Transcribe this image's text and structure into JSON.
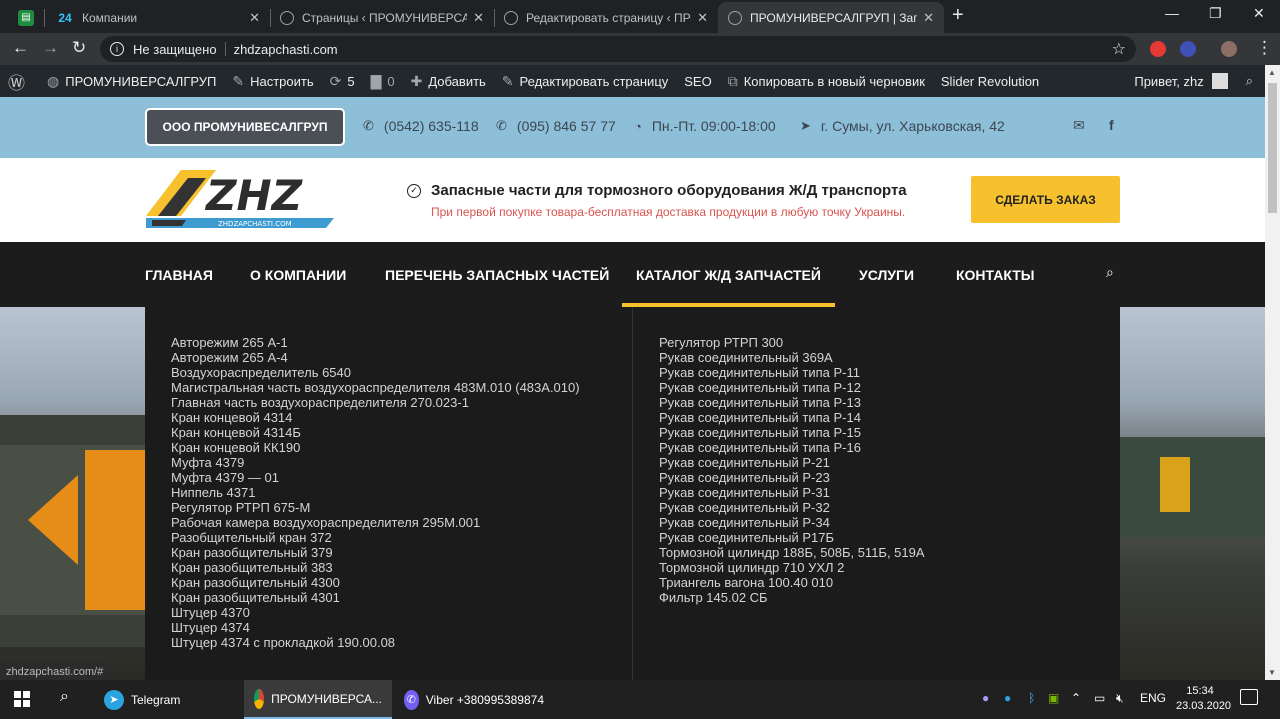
{
  "browser": {
    "tabs": [
      {
        "title": "",
        "favicon": "sheets-icon",
        "color": "#1e8e3e"
      },
      {
        "title": "Компании",
        "favicon": "bitrix24-icon",
        "favicon_text": "24",
        "color": "#2fc6f6"
      },
      {
        "title": "Страницы ‹ ПРОМУНИВЕРСАЛГ",
        "favicon": "globe-icon",
        "color": "#5f6368"
      },
      {
        "title": "Редактировать страницу ‹ ПРОМ",
        "favicon": "globe-icon",
        "color": "#5f6368"
      },
      {
        "title": "ПРОМУНИВЕРСАЛГРУП | Запчас",
        "favicon": "globe-icon",
        "color": "#5f6368"
      }
    ],
    "new_tab": "+",
    "security_label": "Не защищено",
    "url": "zhdzapchasti.com"
  },
  "wp_admin": {
    "site_name": "ПРОМУНИВЕРСАЛГРУП",
    "customize": "Настроить",
    "updates_count": "5",
    "comments_count": "0",
    "add_new": "Добавить",
    "edit_page": "Редактировать страницу",
    "seo": "SEO",
    "copy_draft": "Копировать в новый черновик",
    "slider": "Slider Revolution",
    "greeting": "Привет, zhz"
  },
  "site": {
    "company_button": "ООО ПРОМУНИВЕСАЛГРУП",
    "phone1": "(0542) 635-118",
    "phone2": "(095) 846 57 77",
    "hours": "Пн.-Пт. 09:00-18:00",
    "address": "г. Сумы, ул. Харьковская, 42",
    "logo_text": "ZHZ",
    "logo_sub": "ZHDZAPCHASTI.COM",
    "tagline_main": "Запасные части для тормозного оборудования Ж/Д транспорта",
    "tagline_sub": "При первой покупке товара-бесплатная доставка продукции в любую точку Украины.",
    "order_button": "СДЕЛАТЬ ЗАКАЗ",
    "menu": [
      "ГЛАВНАЯ",
      "О КОМПАНИИ",
      "ПЕРЕЧЕНЬ ЗАПАСНЫХ ЧАСТЕЙ",
      "КАТАЛОГ Ж/Д ЗАПЧАСТЕЙ",
      "УСЛУГИ",
      "КОНТАКТЫ"
    ],
    "accent": "#f6c12d"
  },
  "catalog": {
    "left": [
      "Авторежим 265 А-1",
      "Авторежим 265 А-4",
      "Воздухораспределитель 6540",
      "Магистральная часть воздухораспределителя 483М.010 (483А.010)",
      "Главная часть воздухораспределителя 270.023-1",
      "Кран концевой 4314",
      "Кран концевой 4314Б",
      "Кран концевой КК190",
      "Муфта 4379",
      "Муфта 4379 — 01",
      "Ниппель 4371",
      "Регулятор РТРП 675-М",
      "Рабочая камера воздухораспределителя 295М.001",
      "Разобщительный кран 372",
      "Кран разобщительный 379",
      "Кран разобщительный 383",
      "Кран разобщительный 4300",
      "Кран разобщительный 4301",
      "Штуцер 4370",
      "Штуцер 4374",
      "Штуцер 4374 с прокладкой 190.00.08"
    ],
    "right": [
      "Регулятор РТРП 300",
      "Рукав соединительный 369А",
      "Рукав соединительный типа Р-11",
      "Рукав соединительный типа Р-12",
      "Рукав соединительный типа Р-13",
      "Рукав соединительный типа Р-14",
      "Рукав соединительный типа Р-15",
      "Рукав соединительный типа Р-16",
      "Рукав соединительный Р-21",
      "Рукав соединительный Р-23",
      "Рукав соединительный Р-31",
      "Рукав соединительный Р-32",
      "Рукав соединительный Р-34",
      "Рукав соединительный Р17Б",
      "Тормозной цилиндр 188Б, 508Б, 511Б, 519А",
      "Тормозной цилиндр 710 УХЛ 2",
      "Триангель вагона 100.40 010",
      "Фильтр 145.02 СБ"
    ]
  },
  "status_url": "zhdzapchasti.com/#",
  "taskbar": {
    "apps": [
      {
        "label": "Telegram",
        "color": "#2aa3de"
      },
      {
        "label": "ПРОМУНИВЕРСА...",
        "color": "#db4437"
      },
      {
        "label": "Viber +380995389874",
        "color": "#7360f2"
      }
    ],
    "lang": "ENG",
    "time": "15:34",
    "date": "23.03.2020"
  }
}
